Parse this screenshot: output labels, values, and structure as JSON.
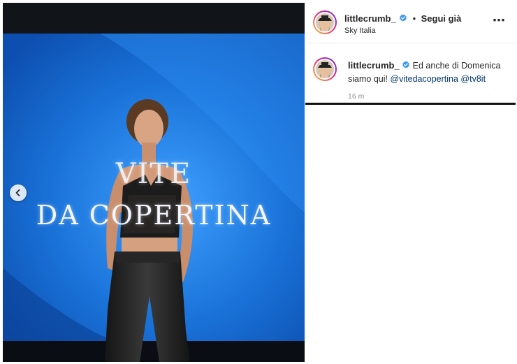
{
  "post": {
    "username": "littlecrumb_",
    "separator": "•",
    "follow_label": "Segui già",
    "location": "Sky Italia",
    "more_icon": "⋯",
    "caption": {
      "username": "littlecrumb_",
      "text": "Ed anche di Domenica siamo qui!",
      "mentions": [
        "@vitedacopertina",
        "@tv8it"
      ],
      "timestamp": "16 m"
    }
  },
  "photo": {
    "screen_title_line1": "VITE",
    "screen_title_line2": "DA COPERTINA",
    "background_color": "#1a73d9"
  },
  "icons": {
    "verified": "verified-badge-icon",
    "prev": "chevron-left-icon",
    "more": "more-options-icon"
  }
}
